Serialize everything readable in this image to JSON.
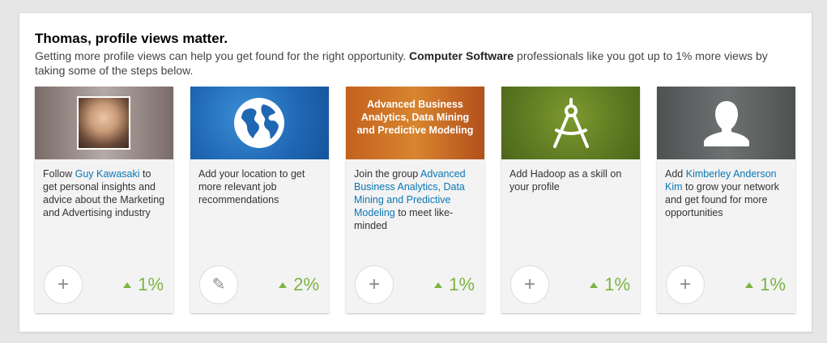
{
  "header": {
    "title": "Thomas, profile views matter.",
    "subtitle_pre": "Getting more profile views can help you get found for the right opportunity.",
    "subtitle_bold": "Computer Software",
    "subtitle_post": "professionals like you got up to 1% more views by taking some of the steps below."
  },
  "cards": [
    {
      "banner_icon": "person-photo",
      "text_pre": "Follow",
      "link": "Guy Kawasaki",
      "text_post": "to get personal insights and advice about the Marketing and Advertising industry",
      "action_icon": "plus-icon",
      "action_symbol": "+",
      "percent": "1%"
    },
    {
      "banner_icon": "globe-icon",
      "text_pre": "Add your location to get more relevant job recommendations",
      "action_icon": "pencil-icon",
      "action_symbol": "✎",
      "percent": "2%"
    },
    {
      "banner_text": "Advanced Business Analytics, Data Mining and Predictive Modeling",
      "text_pre": "Join the group",
      "link": "Advanced Business Analytics, Data Mining and Predictive Modeling",
      "text_post": "to meet like-minded",
      "action_icon": "plus-icon",
      "action_symbol": "+",
      "percent": "1%"
    },
    {
      "banner_icon": "compass-icon",
      "text_pre": "Add Hadoop as a skill on your profile",
      "action_icon": "plus-icon",
      "action_symbol": "+",
      "percent": "1%"
    },
    {
      "banner_icon": "user-silhouette-icon",
      "text_pre": "Add",
      "link": "Kimberley Anderson Kim",
      "text_post": "to grow your network and get found for more opportunities",
      "action_icon": "plus-icon",
      "action_symbol": "+",
      "percent": "1%"
    }
  ],
  "colors": {
    "accent_link": "#0a77b5",
    "increase_green": "#7cb342"
  }
}
